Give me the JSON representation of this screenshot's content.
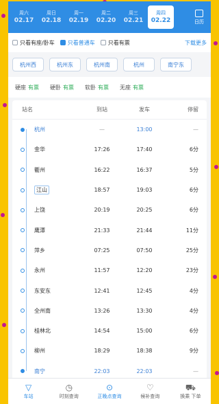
{
  "dates": [
    {
      "weekday": "周六",
      "date": "02.17"
    },
    {
      "weekday": "周日",
      "date": "02.18"
    },
    {
      "weekday": "周一",
      "date": "02.19"
    },
    {
      "weekday": "周二",
      "date": "02.20"
    },
    {
      "weekday": "周三",
      "date": "02.21"
    },
    {
      "weekday": "周四",
      "date": "02.22",
      "selected": true
    }
  ],
  "calendar_label": "日历",
  "filters": {
    "opt1": "只看有座/卧车",
    "opt2": "只看普通车",
    "opt3": "只看有票",
    "more": "下载更多"
  },
  "chips": [
    "杭州西",
    "杭州东",
    "杭州南",
    "杭州",
    "南宁东"
  ],
  "seats": [
    {
      "name": "硬座",
      "status": "有票"
    },
    {
      "name": "硬卧",
      "status": "有票"
    },
    {
      "name": "软卧",
      "status": "有票"
    },
    {
      "name": "无座",
      "status": "有票"
    }
  ],
  "table": {
    "headers": {
      "station": "站名",
      "arrive": "到站",
      "depart": "发车",
      "stay": "停留"
    },
    "rows": [
      {
        "station": "杭州",
        "arrive": "—",
        "depart": "13:00",
        "stay": "—"
      },
      {
        "station": "金华",
        "arrive": "17:26",
        "depart": "17:40",
        "stay": "6分"
      },
      {
        "station": "衢州",
        "arrive": "16:22",
        "depart": "16:37",
        "stay": "5分"
      },
      {
        "station": "江山",
        "arrive": "18:57",
        "depart": "19:03",
        "stay": "6分"
      },
      {
        "station": "上饶",
        "arrive": "20:19",
        "depart": "20:25",
        "stay": "6分"
      },
      {
        "station": "鹰潭",
        "arrive": "21:33",
        "depart": "21:44",
        "stay": "11分"
      },
      {
        "station": "萍乡",
        "arrive": "07:25",
        "depart": "07:50",
        "stay": "25分"
      },
      {
        "station": "永州",
        "arrive": "11:57",
        "depart": "12:20",
        "stay": "23分"
      },
      {
        "station": "东安东",
        "arrive": "12:41",
        "depart": "12:45",
        "stay": "4分"
      },
      {
        "station": "全州南",
        "arrive": "13:26",
        "depart": "13:30",
        "stay": "4分"
      },
      {
        "station": "桂林北",
        "arrive": "14:54",
        "depart": "15:00",
        "stay": "6分"
      },
      {
        "station": "柳州",
        "arrive": "18:29",
        "depart": "18:38",
        "stay": "9分"
      },
      {
        "station": "南宁",
        "arrive": "22:03",
        "depart": "22:03",
        "stay": "—"
      }
    ]
  },
  "tabs": [
    {
      "icon": "▽",
      "label": "车站"
    },
    {
      "icon": "◷",
      "label": "时刻查询"
    },
    {
      "icon": "⊙",
      "label": "正晚点查询"
    },
    {
      "icon": "♡",
      "label": "候补查询"
    },
    {
      "icon": "⛟",
      "label": "换乘 下单"
    }
  ]
}
